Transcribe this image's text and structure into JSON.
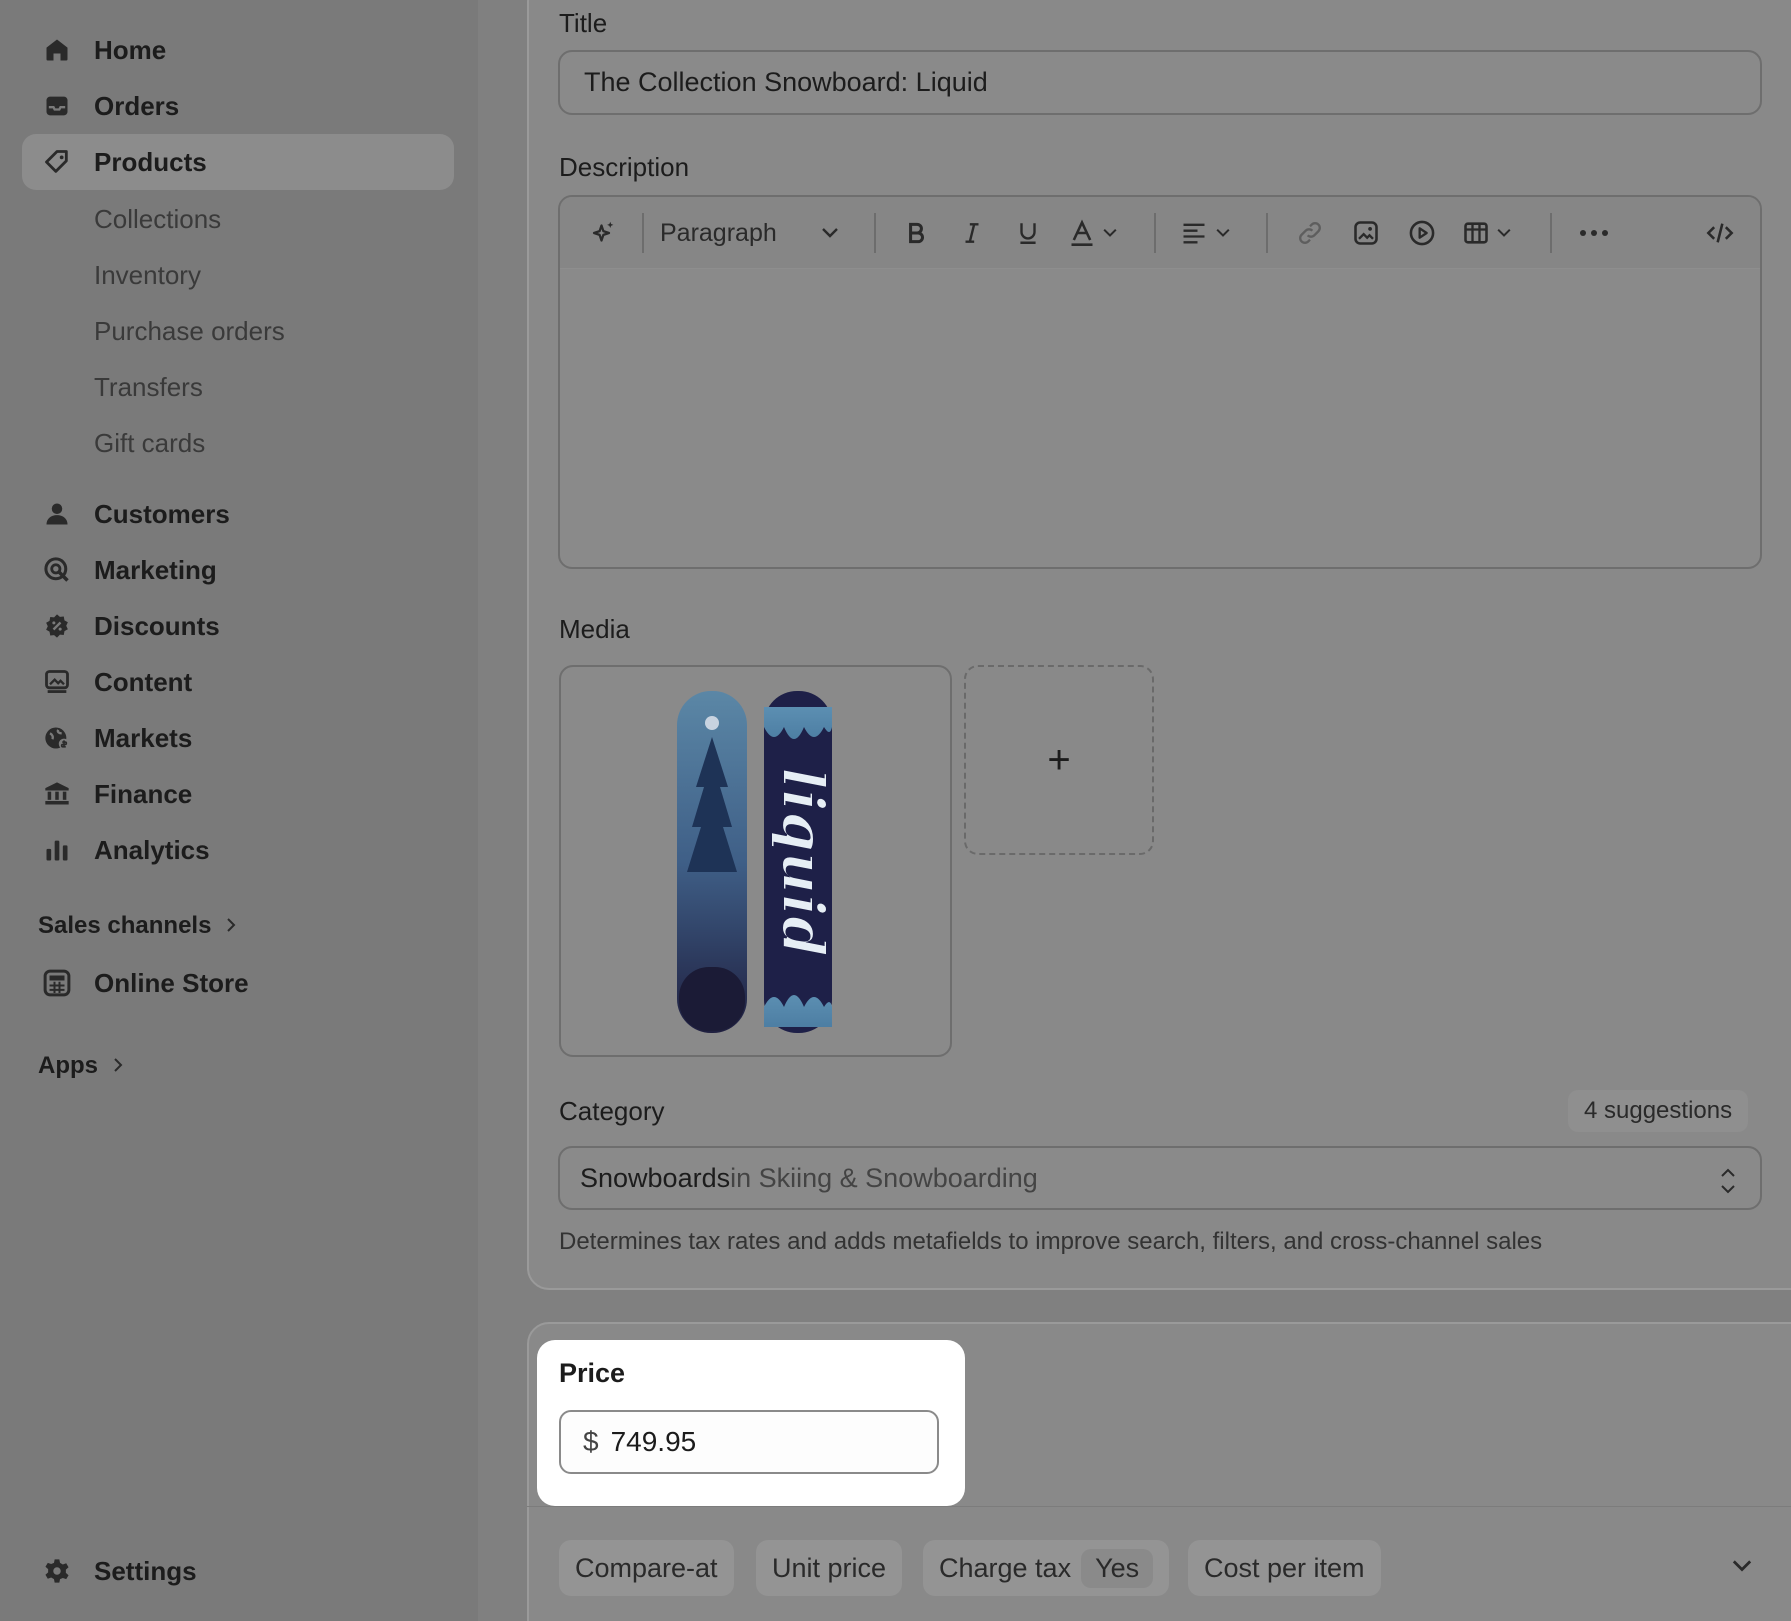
{
  "sidebar": {
    "items": [
      {
        "label": "Home",
        "icon": "home-icon"
      },
      {
        "label": "Orders",
        "icon": "inbox-icon"
      },
      {
        "label": "Products",
        "icon": "tag-icon"
      },
      {
        "label": "Customers",
        "icon": "person-icon"
      },
      {
        "label": "Marketing",
        "icon": "target-icon"
      },
      {
        "label": "Discounts",
        "icon": "discount-icon"
      },
      {
        "label": "Content",
        "icon": "image-icon"
      },
      {
        "label": "Markets",
        "icon": "globe-icon"
      },
      {
        "label": "Finance",
        "icon": "bank-icon"
      },
      {
        "label": "Analytics",
        "icon": "bar-chart-icon"
      }
    ],
    "products_sub": [
      "Collections",
      "Inventory",
      "Purchase orders",
      "Transfers",
      "Gift cards"
    ],
    "sales_channels_label": "Sales channels",
    "online_store_label": "Online Store",
    "apps_label": "Apps",
    "settings_label": "Settings"
  },
  "product": {
    "title_label": "Title",
    "title_value": "The Collection Snowboard: Liquid",
    "description_label": "Description",
    "paragraph_label": "Paragraph",
    "media_label": "Media",
    "add_media_glyph": "+",
    "category_label": "Category",
    "suggestions": "4 suggestions",
    "category_name": "Snowboards",
    "category_parent": " in Skiing & Snowboarding",
    "category_help": "Determines tax rates and adds metafields to improve search, filters, and cross-channel sales"
  },
  "pricing": {
    "price_label": "Price",
    "currency": "$",
    "price_value": "749.95",
    "compare_at": "Compare-at",
    "unit_price": "Unit price",
    "charge_tax": "Charge tax",
    "charge_tax_value": "Yes",
    "cost_per_item": "Cost per item"
  },
  "snowboard_text": "liquid"
}
